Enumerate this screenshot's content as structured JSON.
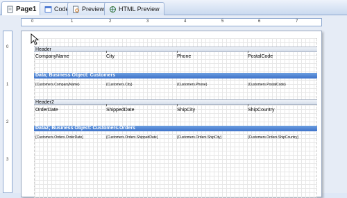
{
  "tabs": [
    {
      "label": "Page1",
      "icon": "page-icon"
    },
    {
      "label": "Code",
      "icon": "code-icon"
    },
    {
      "label": "Preview",
      "icon": "preview-icon"
    },
    {
      "label": "HTML Preview",
      "icon": "html-preview-icon"
    }
  ],
  "ruler": {
    "h_numbers": [
      "0",
      "1",
      "2",
      "3",
      "4",
      "5",
      "6",
      "7"
    ],
    "v_numbers": [
      "0",
      "1",
      "2",
      "3"
    ]
  },
  "bands": {
    "header1_title": "Header",
    "header1_cols": [
      "CompanyName",
      "City",
      "Phone",
      "PostalCode"
    ],
    "data1_title": "Data; Business Object: Customers",
    "data1_cells": [
      "{Customers.CompanyName}",
      "{Customers.City}",
      "{Customers.Phone}",
      "{Customers.PostalCode}"
    ],
    "header2_title": "Header2",
    "header2_cols": [
      "OrderDate",
      "ShippedDate",
      "ShipCity",
      "ShipCountry"
    ],
    "data2_title": "Data2; Business Object: Customers.Orders",
    "data2_cells": [
      "{Customers.Orders.OrderDate}",
      "{Customers.Orders.ShippedDate}",
      "{Customers.Orders.ShipCity}",
      "{Customers.Orders.ShipCountry}"
    ]
  },
  "colors": {
    "data_band": "#3d72c8",
    "title_band": "#d5dde9",
    "workspace": "#e6ecf6"
  }
}
